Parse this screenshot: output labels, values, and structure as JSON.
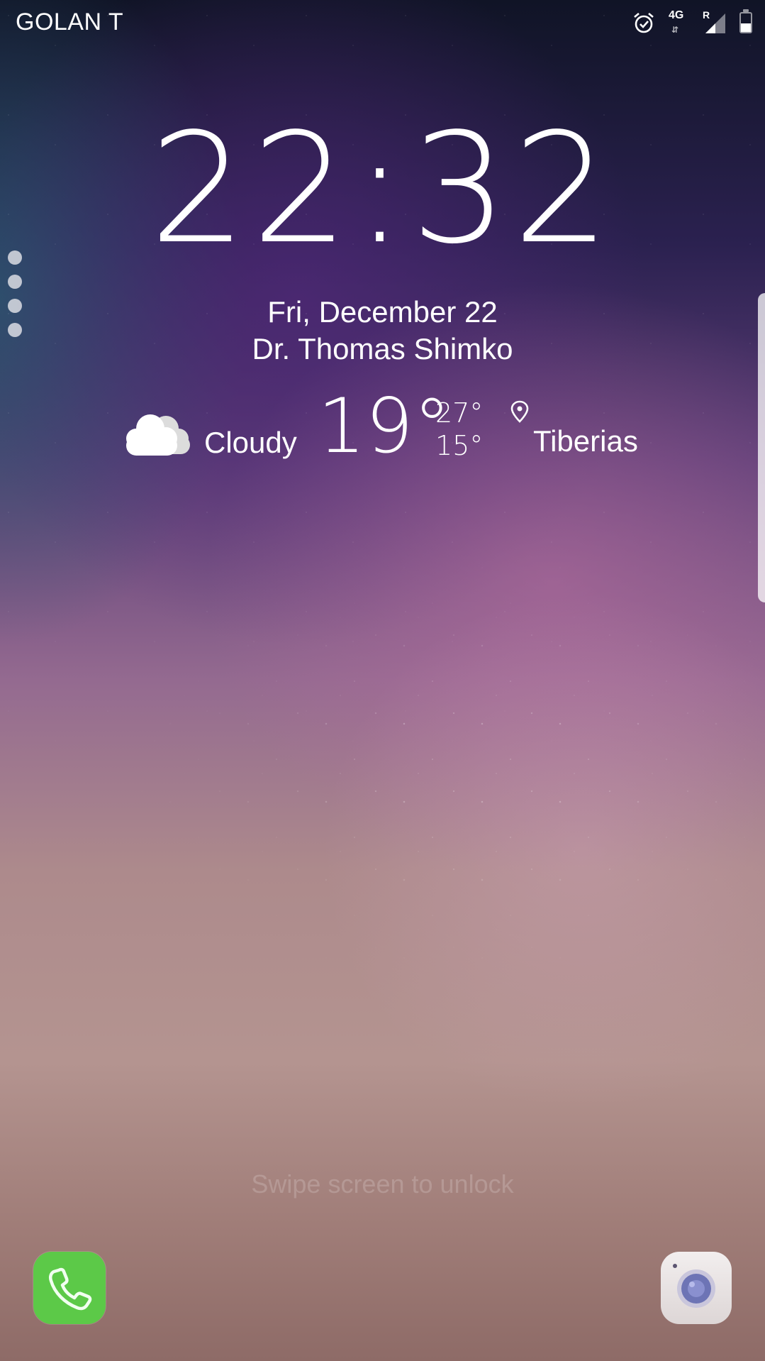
{
  "status_bar": {
    "carrier": "GOLAN T",
    "network_type": "4G",
    "roaming_indicator": "R",
    "icons": [
      "alarm-icon",
      "network-4g-icon",
      "signal-icon",
      "battery-icon"
    ],
    "battery_level": 0.45
  },
  "lock_screen": {
    "time": "22:32",
    "date": "Fri, December 22",
    "owner_info": "Dr. Thomas Shimko",
    "swipe_hint": "Swipe screen to unlock"
  },
  "weather": {
    "condition": "Cloudy",
    "condition_icon": "cloud-icon",
    "temperature": "19°",
    "high": "27°",
    "low": "15°",
    "location": "Tiberias",
    "location_icon": "location-pin-icon"
  },
  "shortcuts": {
    "left": {
      "icon": "phone-icon",
      "color": "#5cc948"
    },
    "right": {
      "icon": "camera-icon",
      "color": "#e9e4e4"
    }
  },
  "edge_panel": {
    "dots_count": 4
  }
}
